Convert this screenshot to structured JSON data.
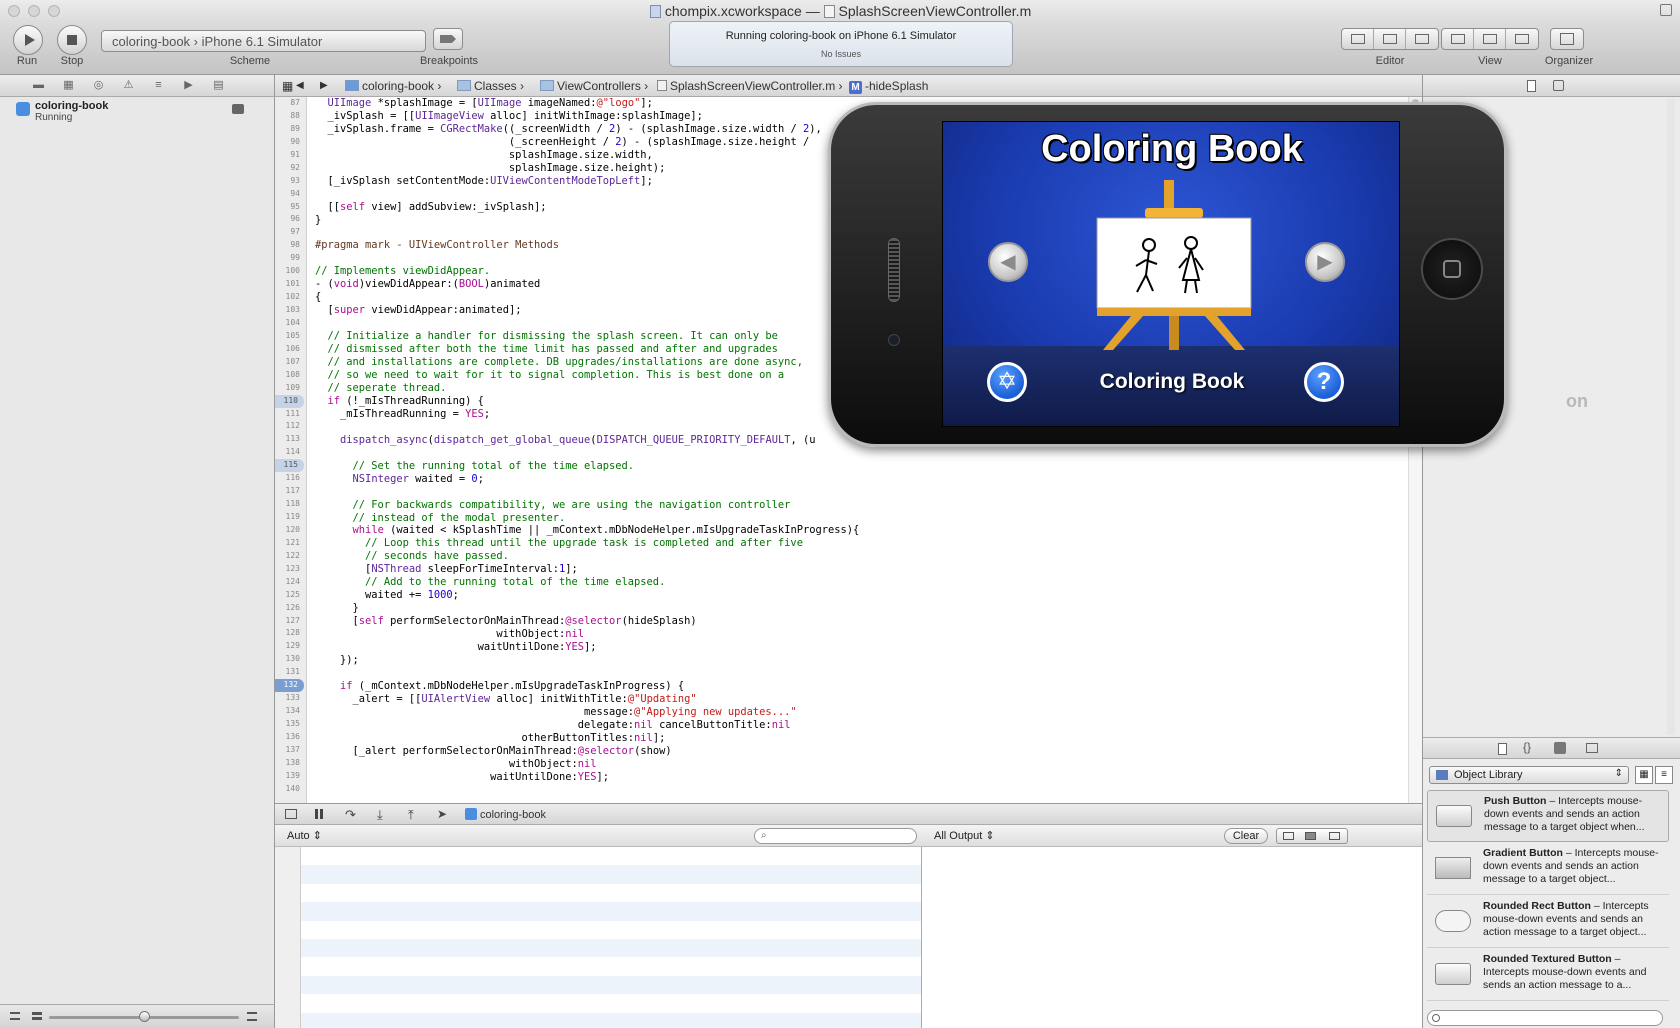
{
  "window": {
    "title_workspace": "chompix.xcworkspace",
    "title_separator": "—",
    "title_file": "SplashScreenViewController.m"
  },
  "toolbar": {
    "run_label": "Run",
    "stop_label": "Stop",
    "scheme_label": "Scheme",
    "breakpoints_label": "Breakpoints",
    "editor_label": "Editor",
    "view_label": "View",
    "organizer_label": "Organizer",
    "scheme_target": "coloring-book",
    "scheme_separator": "›",
    "scheme_device": "iPhone 6.1 Simulator",
    "activity_status": "Running coloring-book on iPhone 6.1 Simulator",
    "activity_issues": "No Issues"
  },
  "navigator": {
    "item_title": "coloring-book",
    "item_status": "Running"
  },
  "jumpbar": {
    "crumbs": [
      "coloring-book",
      "Classes",
      "ViewControllers",
      "SplashScreenViewController.m",
      "-hideSplash"
    ],
    "method_badge": "M"
  },
  "editor": {
    "line_numbers": [
      "87",
      "88",
      "89",
      "90",
      "91",
      "92",
      "93",
      "94",
      "95",
      "96",
      "97",
      "98",
      "99",
      "100",
      "101",
      "102",
      "103",
      "104",
      "105",
      "106",
      "107",
      "108",
      "109",
      "110",
      "111",
      "112",
      "113",
      "114",
      "115",
      "116",
      "117",
      "118",
      "119",
      "120",
      "121",
      "122",
      "123",
      "124",
      "125",
      "126",
      "127",
      "128",
      "129",
      "130",
      "131",
      "132",
      "133",
      "134",
      "135",
      "136",
      "137",
      "138",
      "139",
      "140"
    ],
    "highlighted_lines": [
      "110",
      "115"
    ],
    "breakpoint_line": "132",
    "code": "  UIImage *splashImage = [UIImage imageNamed:@\"logo\"];\n  _ivSplash = [[UIImageView alloc] initWithImage:splashImage];\n  _ivSplash.frame = CGRectMake((_screenWidth / 2) - (splashImage.size.width / 2),\n                               (_screenHeight / 2) - (splashImage.size.height /\n                               splashImage.size.width,\n                               splashImage.size.height);\n  [_ivSplash setContentMode:UIViewContentModeTopLeft];\n\n  [[self view] addSubview:_ivSplash];\n}\n\n#pragma mark - UIViewController Methods\n\n// Implements viewDidAppear.\n- (void)viewDidAppear:(BOOL)animated\n{\n  [super viewDidAppear:animated];\n\n  // Initialize a handler for dismissing the splash screen. It can only be\n  // dismissed after both the time limit has passed and after and upgrades\n  // and installations are complete. DB upgrades/installations are done async,\n  // so we need to wait for it to signal completion. This is best done on a\n  // seperate thread.\n  if (!_mIsThreadRunning) {\n    _mIsThreadRunning = YES;\n\n    dispatch_async(dispatch_get_global_queue(DISPATCH_QUEUE_PRIORITY_DEFAULT, (u\n\n      // Set the running total of the time elapsed.\n      NSInteger waited = 0;\n\n      // For backwards compatibility, we are using the navigation controller\n      // instead of the modal presenter.\n      while (waited < kSplashTime || _mContext.mDbNodeHelper.mIsUpgradeTaskInProgress){\n        // Loop this thread until the upgrade task is completed and after five\n        // seconds have passed.\n        [NSThread sleepForTimeInterval:1];\n        // Add to the running total of the time elapsed.\n        waited += 1000;\n      }\n      [self performSelectorOnMainThread:@selector(hideSplash)\n                             withObject:nil\n                          waitUntilDone:YES];\n    });\n\n    if (_mContext.mDbNodeHelper.mIsUpgradeTaskInProgress) {\n      _alert = [[UIAlertView alloc] initWithTitle:@\"Updating\"\n                                           message:@\"Applying new updates...\"\n                                          delegate:nil cancelButtonTitle:nil\n                                 otherButtonTitles:nil];\n      [_alert performSelectorOnMainThread:@selector(show)\n                               withObject:nil\n                            waitUntilDone:YES];\n"
  },
  "debug": {
    "target": "coloring-book",
    "variables_scope": "Auto",
    "output_scope": "All Output",
    "clear_label": "Clear"
  },
  "simulator": {
    "app_title": "Coloring Book",
    "app_label": "Coloring Book",
    "left_arrow": "◀",
    "right_arrow": "▶",
    "help_glyph": "?",
    "settings_glyph": "✡",
    "partial_background_text": "on"
  },
  "library": {
    "selector_label": "Object Library",
    "items": [
      {
        "title": "Push Button",
        "desc": " – Intercepts mouse-down events and sends an action message to a target object when..."
      },
      {
        "title": "Gradient Button",
        "desc": " – Intercepts mouse-down events and sends an action message to a target object..."
      },
      {
        "title": "Rounded Rect Button",
        "desc": " – Intercepts mouse-down events and sends an action message to a target object..."
      },
      {
        "title": "Rounded Textured Button",
        "desc": " – Intercepts mouse-down events and sends an action message to a..."
      }
    ]
  },
  "colors": {
    "breakpoint_blue": "#7a9ed1",
    "screen_blue": "#2d56d4",
    "keyword_purple": "#aa0d91",
    "comment_green": "#007400",
    "string_red": "#c41a16"
  }
}
